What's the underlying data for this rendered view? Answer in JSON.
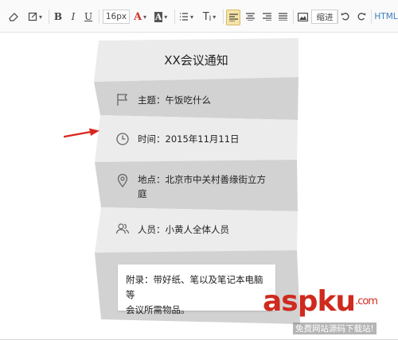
{
  "toolbar": {
    "icons": [
      "eraser-icon",
      "brush-icon",
      "bold",
      "italic",
      "underline",
      "font-size",
      "font-color",
      "highlight",
      "list",
      "heading",
      "align-left",
      "align-center",
      "align-right",
      "align-justify",
      "image",
      "indent",
      "undo",
      "redo"
    ],
    "bold_label": "B",
    "italic_label": "I",
    "underline_label": "U",
    "font_size": "16px",
    "font_color_label": "A",
    "highlight_label": "A",
    "heading_label": "T",
    "indent_label": "缩进",
    "html_label": "HTML",
    "colors": {
      "font": "#d0352b",
      "accent": "#3a7fc1",
      "active": "#f6e3a6"
    }
  },
  "notice": {
    "title": "XX会议通知",
    "rows": [
      {
        "icon": "flag-icon",
        "text": "主题：午饭吃什么"
      },
      {
        "icon": "clock-icon",
        "text": "时间：2015年11月11日"
      },
      {
        "icon": "location-pin-icon",
        "text_line1": "地点：北京市中关村善缘街立方",
        "text_line2": "庭"
      },
      {
        "icon": "people-icon",
        "text": "人员：小黄人全体人员"
      }
    ],
    "appendix_line1": "附录：带好纸、笔以及笔记本电脑等",
    "appendix_line2": "会议所需物品。"
  },
  "watermark": {
    "main": "aspku",
    "dot": ".com",
    "sub": "免费网站源码下载站!"
  }
}
